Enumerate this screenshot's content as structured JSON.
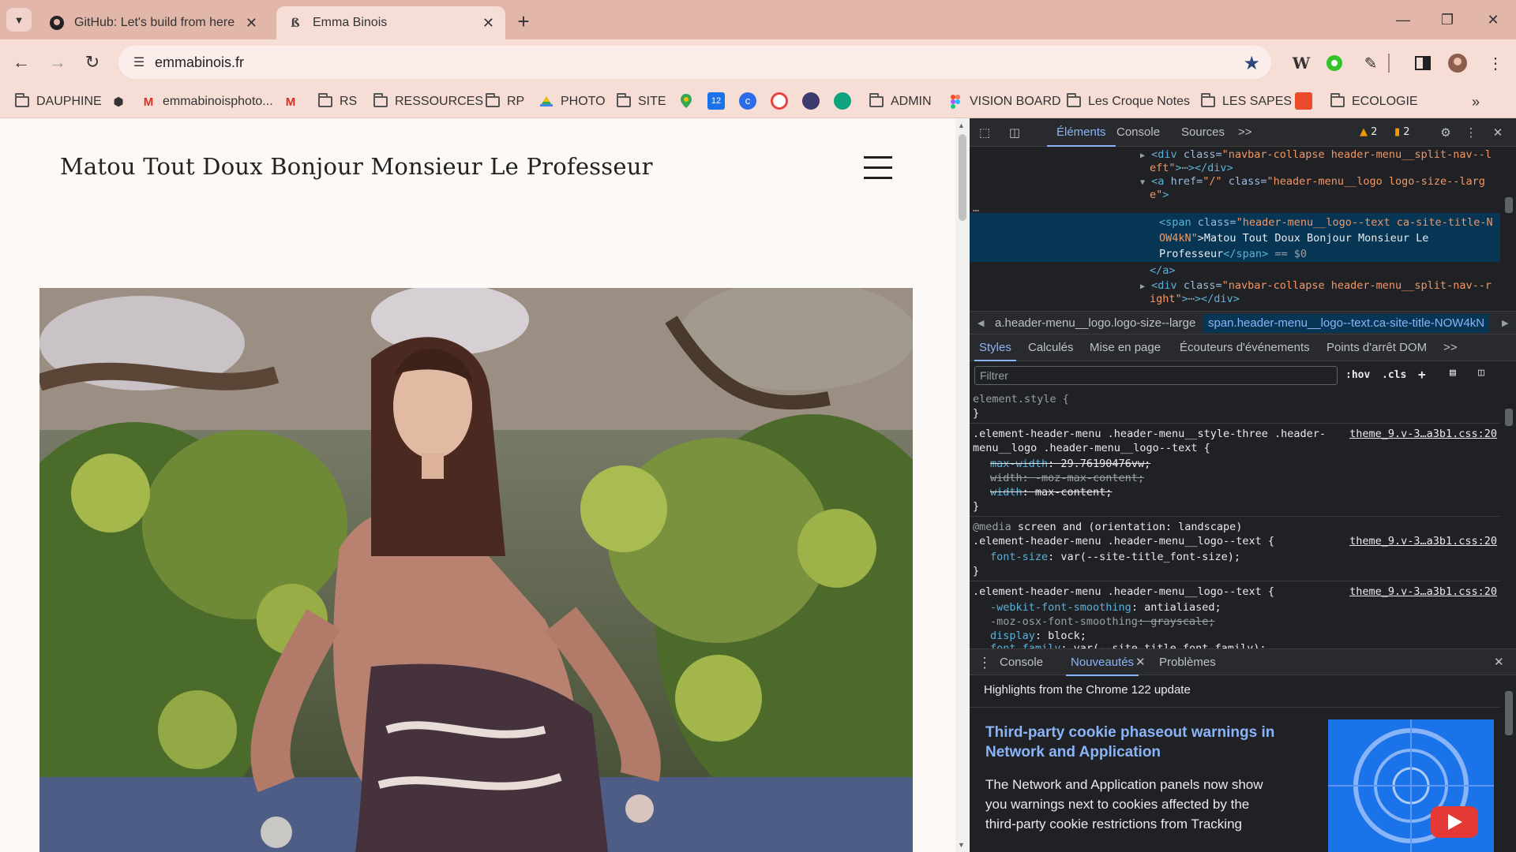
{
  "browser": {
    "tabs": [
      {
        "title": "GitHub: Let's build from here · GitHub",
        "favicon": "github-icon"
      },
      {
        "title": "Emma Binois",
        "favicon": "site-icon"
      }
    ],
    "url": "emmabinois.fr"
  },
  "bookmarks": [
    {
      "label": "DAUPHINE",
      "icon": "folder-icon"
    },
    {
      "label": "",
      "icon": "app-icon"
    },
    {
      "label": "emmabinoisphoto...",
      "icon": "gmail-icon"
    },
    {
      "label": "",
      "icon": "gmail-icon"
    },
    {
      "label": "RS",
      "icon": "folder-icon"
    },
    {
      "label": "RESSOURCES",
      "icon": "folder-icon"
    },
    {
      "label": "RP",
      "icon": "folder-icon"
    },
    {
      "label": "PHOTO",
      "icon": "drive-icon"
    },
    {
      "label": "SITE",
      "icon": "folder-icon"
    },
    {
      "label": "ADMIN",
      "icon": "folder-icon"
    },
    {
      "label": "VISION BOARD",
      "icon": "figma-icon"
    },
    {
      "label": "Les Croque Notes",
      "icon": "folder-icon"
    },
    {
      "label": "LES SAPES",
      "icon": "folder-icon"
    },
    {
      "label": "ECOLOGIE",
      "icon": "folder-icon"
    }
  ],
  "page": {
    "site_title": "Matou Tout Doux Bonjour Monsieur Le Professeur"
  },
  "devtools": {
    "tabs": [
      "Éléments",
      "Console",
      "Sources",
      ">>"
    ],
    "warnings": "2",
    "issues": "2",
    "dom": {
      "l1_tag": "<div ",
      "l1_attr": "class=",
      "l1_val": "\"navbar-collapse header-menu__split-nav--l",
      "l1b_val": "eft\"",
      "l1b_end": "></div>",
      "l2_tag": "<a ",
      "l2_attr1": "href=",
      "l2_val1": "\"/\"",
      "l2_attr2": " class=",
      "l2_val2": "\"header-menu__logo logo-size--larg",
      "l2b_val": "e\"",
      "l2b_end": ">",
      "l3_tag": "<span ",
      "l3_attr": "class=",
      "l3_val": "\"header-menu__logo--text ca-site-title-N",
      "l3b_val": "OW4kN\"",
      "l3b_text": ">Matou Tout Doux Bonjour Monsieur Le",
      "l3c_text": "Professeur",
      "l3c_end": "</span>",
      "l3c_eq": " == $0",
      "l4_end": "</a>",
      "l5_tag": "<div ",
      "l5_attr": "class=",
      "l5_val": "\"navbar-collapse header-menu__split-nav--r",
      "l5b_val": "ight\"",
      "l5b_end": "></div>",
      "dots": "…"
    },
    "breadcrumbs": [
      "a.header-menu__logo.logo-size--large",
      "span.header-menu__logo--text.ca-site-title-NOW4kN"
    ],
    "subtabs": [
      "Styles",
      "Calculés",
      "Mise en page",
      "Écouteurs d'événements",
      "Points d'arrêt DOM",
      ">>"
    ],
    "filter_placeholder": "Filtrer",
    "filter_hov": ":hov",
    "filter_cls": ".cls",
    "styles": {
      "r0_sel": "element.style {",
      "r0_end": "}",
      "r1_sel": ".element-header-menu .header-menu__style-three .header-",
      "r1_sel2": "menu__logo .header-menu__logo--text {",
      "r1_link": "theme_9.v-3…a3b1.css:20",
      "r1_p1": "max-width",
      "r1_v1": ": 29.76190476vw;",
      "r1_p2": "width",
      "r1_v2": ": -moz-max-content;",
      "r1_p3": "width",
      "r1_v3": ": max-content;",
      "r1_end": "}",
      "r2_media": "@media",
      "r2_mq": " screen and (orientation: landscape)",
      "r2_sel": ".element-header-menu .header-menu__logo--text {",
      "r2_link": "theme_9.v-3…a3b1.css:20",
      "r2_p1": "font-size",
      "r2_v1": ": var(--site-title_font-size);",
      "r2_end": "}",
      "r3_sel": ".element-header-menu .header-menu__logo--text {",
      "r3_link": "theme_9.v-3…a3b1.css:20",
      "r3_p1": "-webkit-font-smoothing",
      "r3_v1": ": antialiased;",
      "r3_p2": "-moz-osx-font-smoothing",
      "r3_v2": ": grayscale;",
      "r3_p3": "display",
      "r3_v3": ": block;",
      "r3_p4": "font-family",
      "r3_v4": ": var(--site-title_font-family);"
    },
    "drawer_tabs": [
      "Console",
      "Nouveautés",
      "Problèmes"
    ],
    "whatsnew": {
      "heading": "Highlights from the Chrome 122 update",
      "title": "Third-party cookie phaseout warnings in Network and Application",
      "body": "The Network and Application panels now show you warnings next to cookies affected by the third-party cookie restrictions from Tracking"
    }
  }
}
